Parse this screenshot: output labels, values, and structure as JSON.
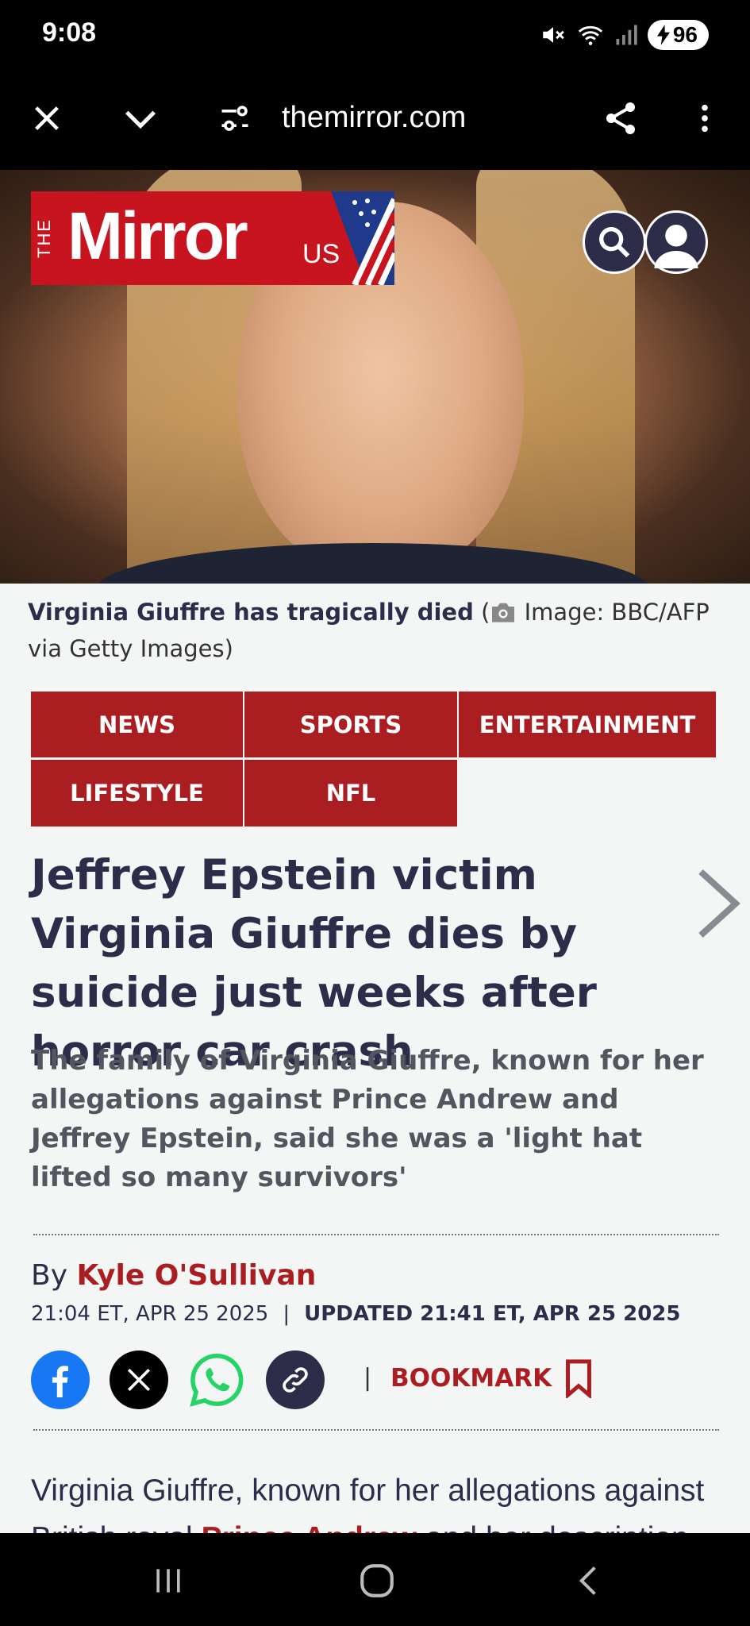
{
  "status_bar": {
    "time": "9:08",
    "battery": "96",
    "icons": [
      "mute-icon",
      "wifi-icon",
      "signal-icon",
      "battery-charging-icon"
    ]
  },
  "browser": {
    "url": "themirror.com",
    "icons": [
      "close-icon",
      "chevron-down-icon",
      "site-settings-icon",
      "share-icon",
      "more-vert-icon"
    ]
  },
  "site": {
    "logo_the": "THE",
    "logo_name": "Mirror",
    "logo_region": "US",
    "icons": [
      "search-icon",
      "account-icon"
    ]
  },
  "caption": {
    "text": "Virginia Giuffre has tragically died",
    "open_paren": " (",
    "credit": " Image: BBC/AFP via Getty Images)"
  },
  "nav": {
    "items": [
      "NEWS",
      "SPORTS",
      "ENTERTAINMENT",
      "LIFESTYLE",
      "NFL"
    ]
  },
  "article": {
    "headline": "Jeffrey Epstein victim Virginia Giuffre dies by suicide just weeks after horror car crash",
    "dek": "The family of Virginia Giuffre, known for her allegations against Prince Andrew and Jeffrey Epstein, said she was a 'light hat lifted so many survivors'",
    "byline_prefix": "By ",
    "author": "Kyle O'Sullivan",
    "published": "21:04 ET, APR 25 2025",
    "separator": "|",
    "updated": "UPDATED 21:41 ET, APR 25 2025",
    "share_icons": [
      "facebook-icon",
      "x-icon",
      "whatsapp-icon",
      "link-icon"
    ],
    "bookmark": "BOOKMARK",
    "body_line1": "Virginia Giuffre, known for her allegations against",
    "body_line2_start": "British royal ",
    "body_link": "Prince Andrew",
    "body_line2_end": " and her description"
  },
  "colors": {
    "brand_red": "#c8141e",
    "nav_red": "#aa1e22",
    "headline": "#2d2d4a",
    "facebook": "#1877f2",
    "whatsapp": "#25d366"
  },
  "system_nav": {
    "icons": [
      "recent-apps-icon",
      "home-icon",
      "back-icon"
    ]
  }
}
